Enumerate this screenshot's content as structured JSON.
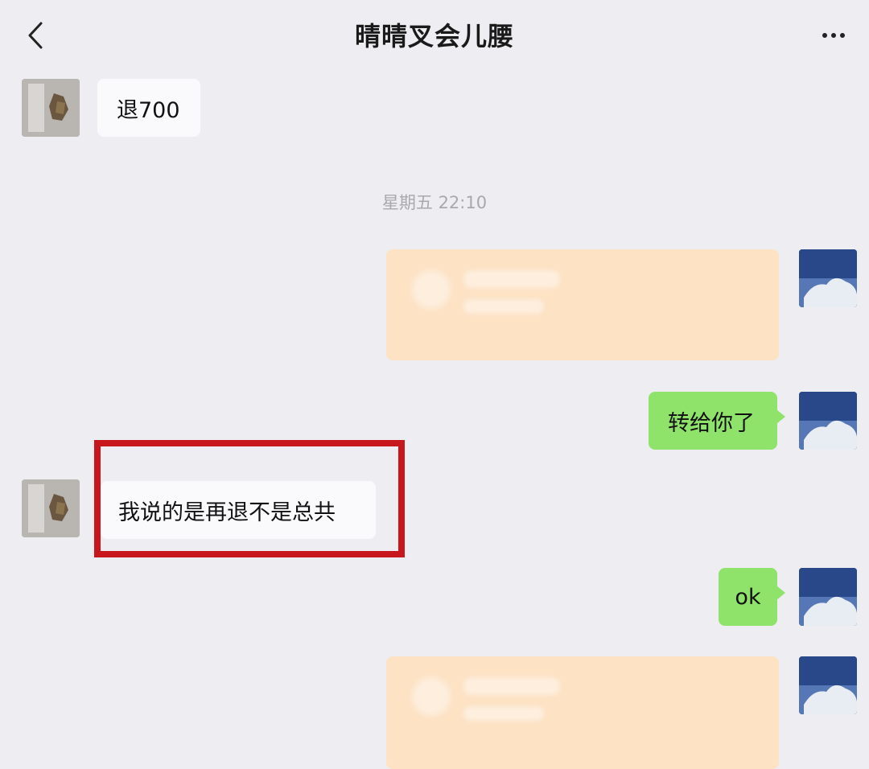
{
  "header": {
    "title": "晴晴叉会儿腰",
    "back_icon": "chevron-left-icon",
    "more_icon": "more-dots-icon"
  },
  "timestamp": "星期五 22:10",
  "messages": [
    {
      "side": "left",
      "type": "text",
      "text": "退700"
    },
    {
      "side": "right",
      "type": "transfer"
    },
    {
      "side": "right",
      "type": "text",
      "text": "转给你了"
    },
    {
      "side": "left",
      "type": "text",
      "text": "我说的是再退不是总共",
      "highlighted": true
    },
    {
      "side": "right",
      "type": "text",
      "text": "ok"
    },
    {
      "side": "right",
      "type": "transfer"
    }
  ],
  "colors": {
    "background": "#ededf2",
    "bubble_self": "#8fe36b",
    "bubble_other": "#fafafc",
    "transfer_card": "#fde2c4",
    "highlight_border": "#c8161d",
    "timestamp_text": "#a8a8ae"
  }
}
